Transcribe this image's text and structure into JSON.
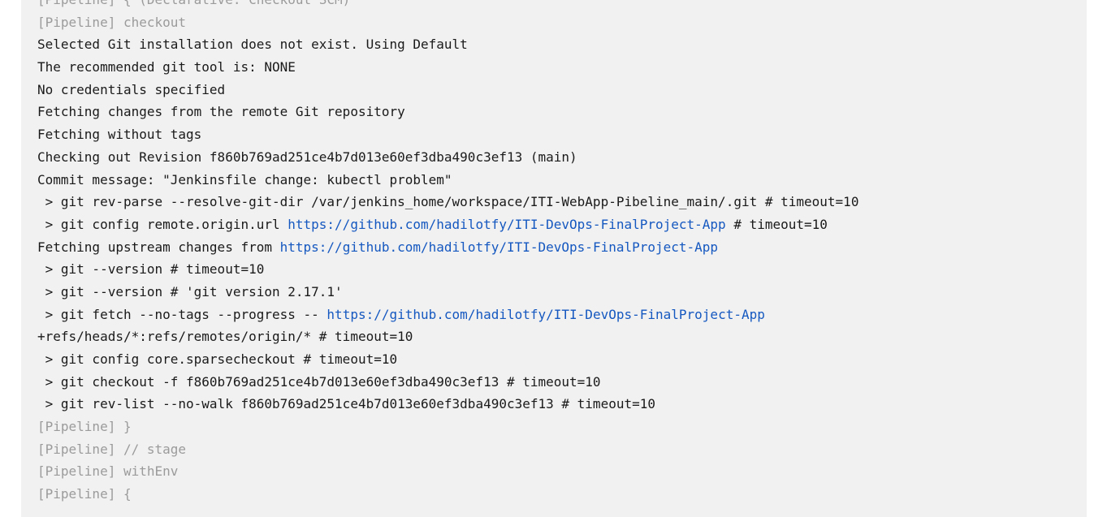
{
  "console": {
    "lines": [
      {
        "type": "pipeline",
        "text": "[Pipeline] { (Declarative: Checkout SCM)"
      },
      {
        "type": "pipeline",
        "text": "[Pipeline] checkout"
      },
      {
        "type": "plain",
        "text": "Selected Git installation does not exist. Using Default"
      },
      {
        "type": "plain",
        "text": "The recommended git tool is: NONE"
      },
      {
        "type": "plain",
        "text": "No credentials specified"
      },
      {
        "type": "plain",
        "text": "Fetching changes from the remote Git repository"
      },
      {
        "type": "plain",
        "text": "Fetching without tags"
      },
      {
        "type": "plain",
        "text": "Checking out Revision f860b769ad251ce4b7d013e60ef3dba490c3ef13 (main)"
      },
      {
        "type": "plain",
        "text": "Commit message: \"Jenkinsfile change: kubectl problem\""
      },
      {
        "type": "plain",
        "text": " > git rev-parse --resolve-git-dir /var/jenkins_home/workspace/ITI-WebApp-Pibeline_main/.git # timeout=10"
      },
      {
        "type": "link",
        "before": " > git config remote.origin.url ",
        "link": "https://github.com/hadilotfy/ITI-DevOps-FinalProject-App",
        "after": " # timeout=10"
      },
      {
        "type": "link",
        "before": "Fetching upstream changes from ",
        "link": "https://github.com/hadilotfy/ITI-DevOps-FinalProject-App",
        "after": ""
      },
      {
        "type": "plain",
        "text": " > git --version # timeout=10"
      },
      {
        "type": "plain",
        "text": " > git --version # 'git version 2.17.1'"
      },
      {
        "type": "link",
        "before": " > git fetch --no-tags --progress -- ",
        "link": "https://github.com/hadilotfy/ITI-DevOps-FinalProject-App",
        "after": ""
      },
      {
        "type": "plain",
        "text": "+refs/heads/*:refs/remotes/origin/* # timeout=10"
      },
      {
        "type": "plain",
        "text": " > git config core.sparsecheckout # timeout=10"
      },
      {
        "type": "plain",
        "text": " > git checkout -f f860b769ad251ce4b7d013e60ef3dba490c3ef13 # timeout=10"
      },
      {
        "type": "plain",
        "text": " > git rev-list --no-walk f860b769ad251ce4b7d013e60ef3dba490c3ef13 # timeout=10"
      },
      {
        "type": "pipeline",
        "text": "[Pipeline] }"
      },
      {
        "type": "pipeline",
        "text": "[Pipeline] // stage"
      },
      {
        "type": "pipeline",
        "text": "[Pipeline] withEnv"
      },
      {
        "type": "pipeline",
        "text": "[Pipeline] {"
      }
    ]
  }
}
